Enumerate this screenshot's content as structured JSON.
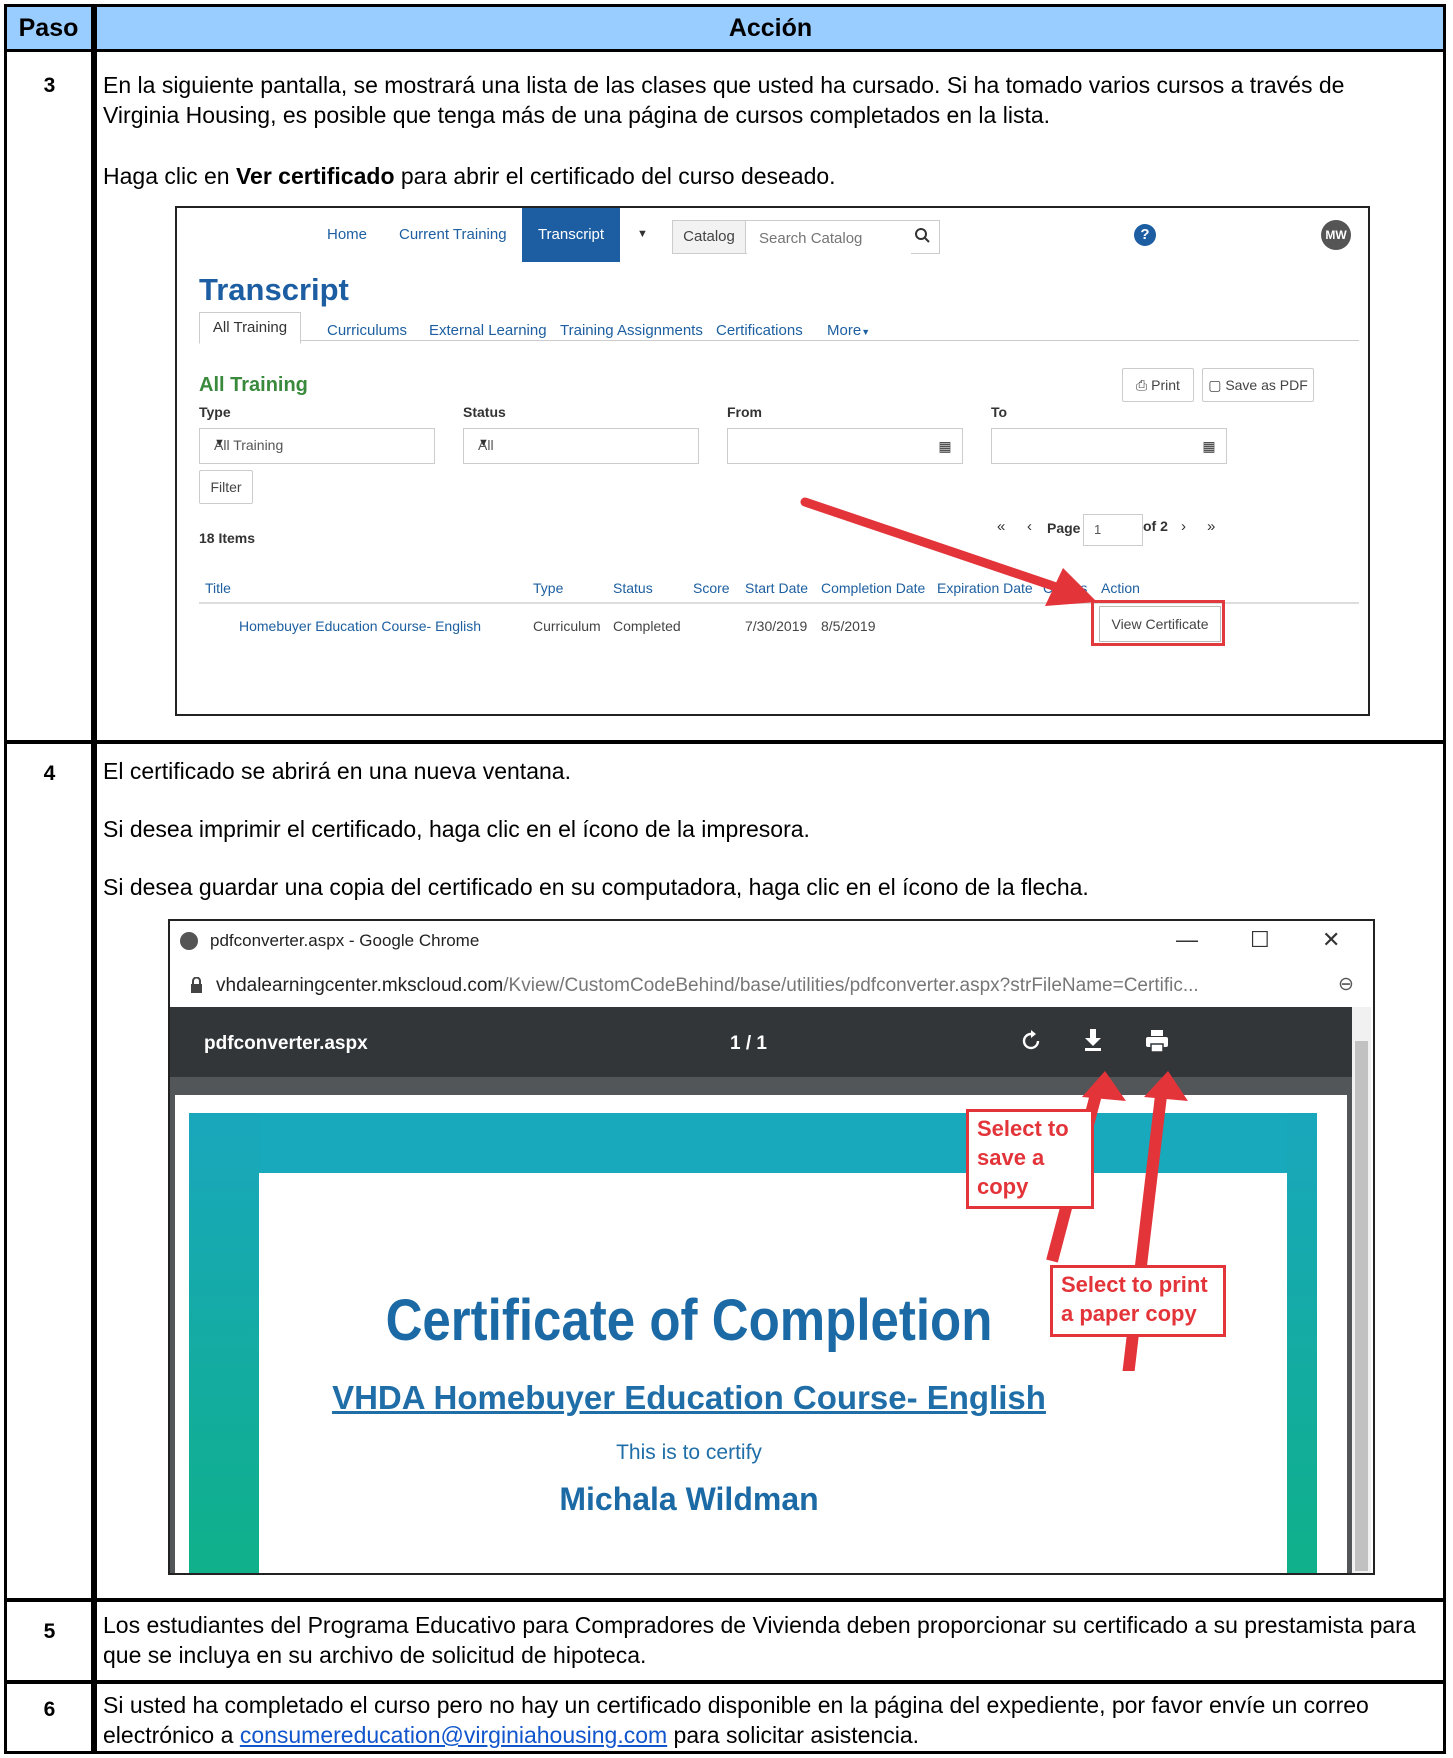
{
  "table": {
    "col_step": "Paso",
    "col_action": "Acción"
  },
  "steps": [
    {
      "num": "3",
      "p1": "En la siguiente pantalla, se mostrará una lista de las clases que usted ha cursado. Si ha tomado varios cursos a través de Virginia Housing, es posible que tenga más de una página de cursos completados en la lista.",
      "p2_pre": "Haga clic en ",
      "p2_bold": "Ver certificado",
      "p2_post": " para abrir el certificado del curso deseado."
    },
    {
      "num": "4",
      "p1": "El certificado se abrirá en una nueva ventana.",
      "p2": "Si desea imprimir el certificado, haga clic en el ícono de la impresora.",
      "p3": "Si desea guardar una copia del certificado en su computadora, haga clic en el ícono de la flecha."
    },
    {
      "num": "5",
      "p1": "Los estudiantes del Programa Educativo para Compradores de Vivienda deben proporcionar su certificado a su prestamista para que se incluya en su archivo de solicitud de hipoteca."
    },
    {
      "num": "6",
      "p1_pre": "Si usted ha completado el curso pero no hay un certificado disponible en la página del expediente, por favor envíe un correo electrónico a ",
      "p1_link": "consumereducation@virginiahousing.com",
      "p1_post": " para solicitar asistencia."
    }
  ],
  "lms": {
    "nav": [
      "Home",
      "Current Training",
      "Transcript"
    ],
    "catalog_label": "Catalog",
    "search_placeholder": "Search Catalog",
    "avatar": "MW",
    "help": "?",
    "page_title": "Transcript",
    "tabs": [
      "All Training",
      "Curriculums",
      "External Learning",
      "Training Assignments",
      "Certifications",
      "More"
    ],
    "section_title": "All Training",
    "print_label": "Print",
    "save_pdf_label": "Save as PDF",
    "filters": {
      "type_label": "Type",
      "type_value": "All Training",
      "status_label": "Status",
      "status_value": "All",
      "from_label": "From",
      "to_label": "To"
    },
    "filter_button": "Filter",
    "items_count": "18 Items",
    "pager": {
      "page_label": "Page",
      "page_value": "1",
      "of_label": "of 2"
    },
    "columns": [
      "Title",
      "Type",
      "Status",
      "Score",
      "Start Date",
      "Completion Date",
      "Expiration Date",
      "Credits",
      "Action"
    ],
    "row": {
      "title": "Homebuyer Education Course- English",
      "type": "Curriculum",
      "status": "Completed",
      "start": "7/30/2019",
      "completion": "8/5/2019",
      "action": "View Certificate"
    }
  },
  "chrome": {
    "window_title": "pdfconverter.aspx - Google Chrome",
    "url_host": "vhdalearningcenter.mkscloud.com",
    "url_path": "/Kview/CustomCodeBehind/base/utilities/pdfconverter.aspx?strFileName=Certific...",
    "pdf_name": "pdfconverter.aspx",
    "pdf_page": "1 / 1",
    "cert_title": "Certificate of Completion",
    "cert_course": "VHDA Homebuyer Education Course- English",
    "cert_sub": "This is to certify",
    "cert_name": "Michala Wildman",
    "callout_save": "Select to save a copy",
    "callout_print": "Select to print a paper copy"
  },
  "colors": {
    "header_bg": "#99ccff",
    "accent_red": "#e3343a",
    "lms_blue": "#1d5ea3"
  }
}
